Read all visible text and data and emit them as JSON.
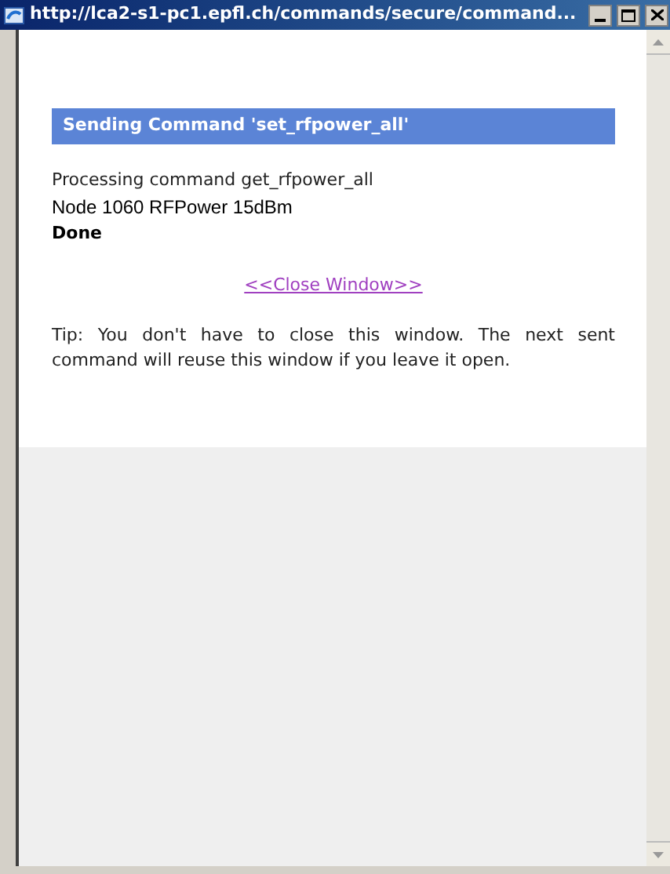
{
  "window": {
    "title": "http://lca2-s1-pc1.epfl.ch/commands/secure/command..."
  },
  "heading": "Sending Command 'set_rfpower_all'",
  "log": [
    {
      "text": "Processing command get_rfpower_all",
      "kind": "status"
    },
    {
      "text": "Node 1060 RFPower 15dBm",
      "kind": "result"
    },
    {
      "text": "Done",
      "kind": "done"
    }
  ],
  "close_link": "<<Close Window>>",
  "tip": "Tip: You don't have to close this window. The next sent command will reuse this window if you leave it open."
}
